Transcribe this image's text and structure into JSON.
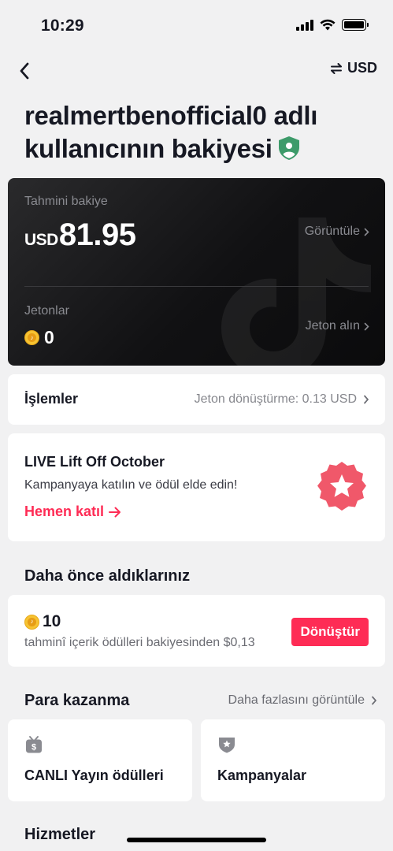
{
  "status_bar": {
    "time": "10:29"
  },
  "nav": {
    "currency_label": "USD"
  },
  "page": {
    "title": "realmertbenofficial0 adlı kullanıcının bakiyesi"
  },
  "balance_card": {
    "estimated_label": "Tahmini bakiye",
    "currency": "USD",
    "amount": "81.95",
    "view_link": "Görüntüle",
    "coins_label": "Jetonlar",
    "coins_amount": "0",
    "get_coins_link": "Jeton alın"
  },
  "transactions": {
    "title": "İşlemler",
    "rate": "Jeton dönüştürme: 0.13 USD"
  },
  "promo": {
    "title": "LIVE Lift Off October",
    "subtitle": "Kampanyaya katılın ve ödül elde edin!",
    "cta": "Hemen katıl"
  },
  "previously_received": {
    "title": "Daha önce aldıklarınız",
    "amount": "10",
    "description": "tahminî içerik ödülleri bakiyesinden $0,13",
    "convert_label": "Dönüştür"
  },
  "monetization": {
    "title": "Para kazanma",
    "see_more": "Daha fazlasını görüntüle",
    "tiles": [
      {
        "label": "CANLI Yayın ödülleri",
        "icon": "live-gift-icon"
      },
      {
        "label": "Kampanyalar",
        "icon": "campaign-badge-icon"
      }
    ]
  },
  "services": {
    "title": "Hizmetler"
  },
  "colors": {
    "accent": "#fe2c55",
    "coin": "#f6c332",
    "shield": "#3d9b6a"
  }
}
